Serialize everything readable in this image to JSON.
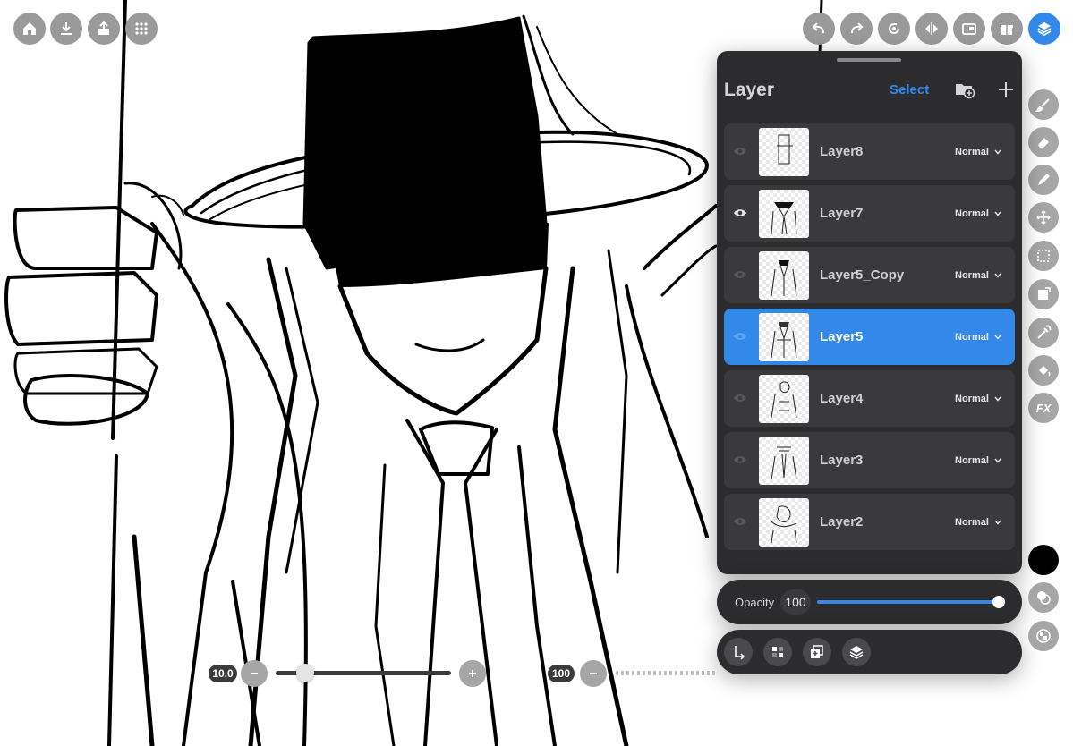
{
  "layer_panel": {
    "title": "Layer",
    "select_label": "Select",
    "layers": [
      {
        "name": "Layer8",
        "blend": "Normal",
        "visible": false,
        "selected": false
      },
      {
        "name": "Layer7",
        "blend": "Normal",
        "visible": true,
        "selected": false
      },
      {
        "name": "Layer5_Copy",
        "blend": "Normal",
        "visible": false,
        "selected": false
      },
      {
        "name": "Layer5",
        "blend": "Normal",
        "visible": false,
        "selected": true
      },
      {
        "name": "Layer4",
        "blend": "Normal",
        "visible": false,
        "selected": false
      },
      {
        "name": "Layer3",
        "blend": "Normal",
        "visible": false,
        "selected": false
      },
      {
        "name": "Layer2",
        "blend": "Normal",
        "visible": false,
        "selected": false
      }
    ]
  },
  "opacity": {
    "label": "Opacity",
    "value": "100",
    "level": 1.0
  },
  "brush_size": {
    "value": "10.0",
    "level": 0.17
  },
  "brush_opacity": {
    "value": "100",
    "level": 1.0
  },
  "colors": {
    "accent": "#3289ea",
    "panel": "#2c2c2e",
    "current_color": "#000000"
  },
  "top_left_icons": [
    "home-icon",
    "download-icon",
    "share-icon",
    "grid-icon"
  ],
  "top_right_icons": [
    "undo-icon",
    "redo-icon",
    "rotate-icon",
    "flip-icon",
    "reference-icon",
    "gift-icon",
    "layers-icon"
  ],
  "side_tools": [
    "brush-icon",
    "eraser-icon",
    "pen-icon",
    "move-icon",
    "select-rect-icon",
    "transform-icon",
    "eyedropper-icon",
    "fill-icon",
    "fx-icon"
  ],
  "fx_label": "FX"
}
